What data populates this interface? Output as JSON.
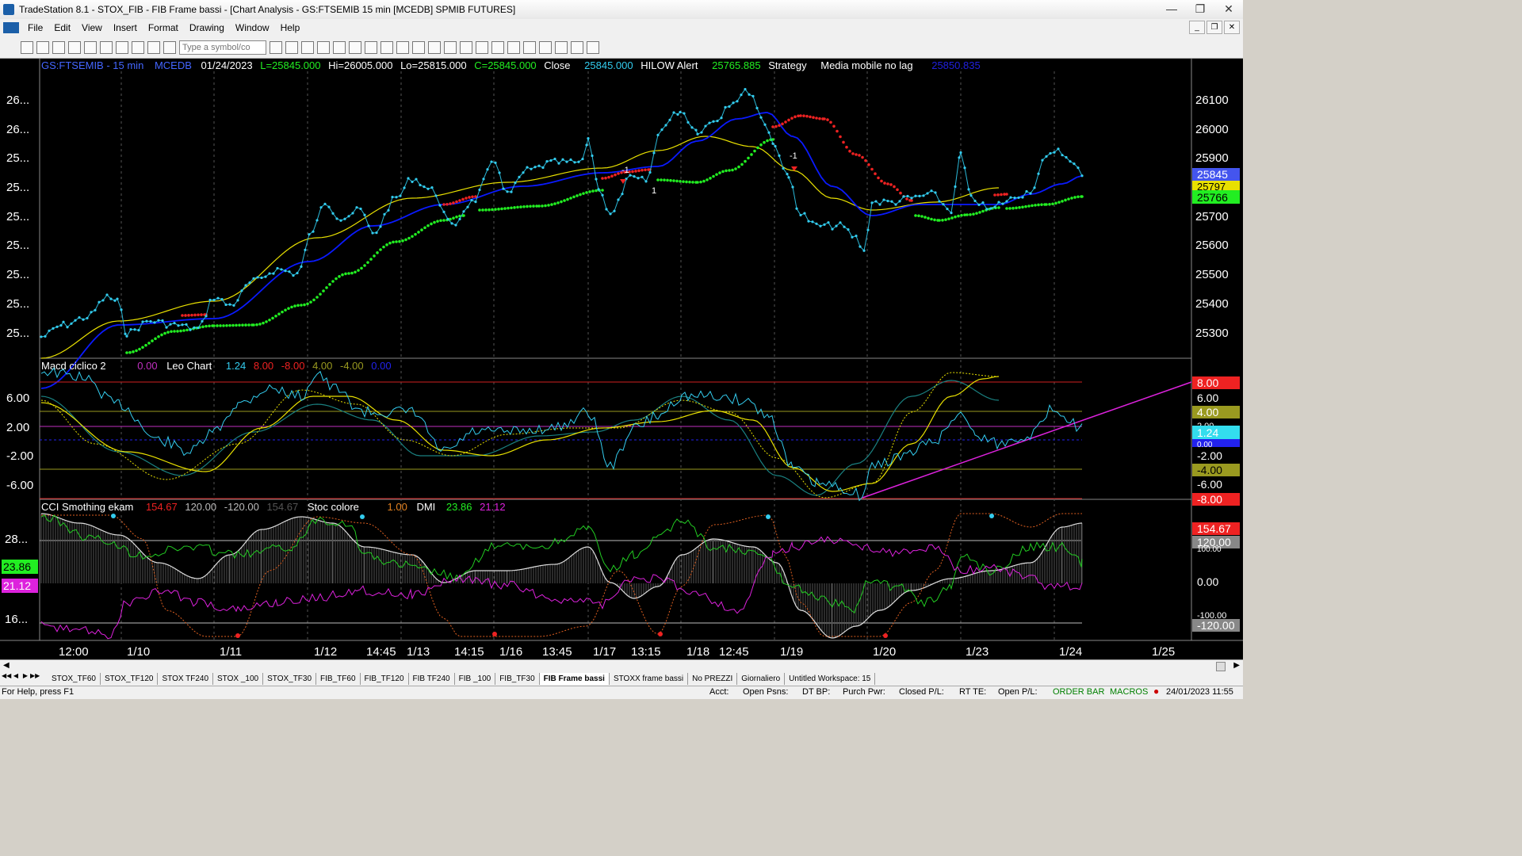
{
  "window": {
    "title": "TradeStation 8.1 - STOX_FIB - FIB Frame bassi - [Chart Analysis - GS:FTSEMIB  15 min  [MCEDB] SPMIB FUTURES]",
    "minimize": "—",
    "maximize": "❐",
    "close": "✕"
  },
  "menu": {
    "items": [
      "File",
      "Edit",
      "View",
      "Insert",
      "Format",
      "Drawing",
      "Window",
      "Help"
    ],
    "mdi": [
      "_",
      "❐",
      "✕"
    ]
  },
  "toolbar": {
    "symbol_placeholder": "Type a symbol/co"
  },
  "chart": {
    "header": {
      "symbol": "GS:FTSEMIB - 15 min",
      "exchange": "MCEDB",
      "date": "01/24/2023",
      "last": "L=25845.000",
      "high": "Hi=26005.000",
      "low": "Lo=25815.000",
      "close_val": "C=25845.000",
      "close_label": "Close",
      "close_num": "25845.000",
      "hilow_label": "HILOW Alert",
      "hilow_val": "25765.885",
      "strategy": "Strategy",
      "mm_label": "Media mobile no lag",
      "mm_val": "25850.835"
    },
    "price_axis": [
      "26100",
      "26000",
      "25900",
      "25800",
      "25700",
      "25600",
      "25500",
      "25400",
      "25300"
    ],
    "left_axis": [
      "26...",
      "26...",
      "25...",
      "25...",
      "25...",
      "25...",
      "25...",
      "25...",
      "25..."
    ],
    "price_tags": {
      "last": "25845",
      "yellow": "25797",
      "green": "25766"
    },
    "markers": {
      "m1": "-1",
      "m2": "1",
      "m3": "-1"
    },
    "macd": {
      "title": "Macd ciclico 2",
      "val1": "0.00",
      "leo": "Leo Chart",
      "v_cyan": "1.24",
      "v_red": "8.00",
      "v_red2": "-8.00",
      "v_olive": "4.00",
      "v_olive2": "-4.00",
      "v_blue": "0.00",
      "axis": [
        "6.00",
        "2.00",
        "-2.00",
        "-6.00"
      ],
      "tags": {
        "t8": "8.00",
        "t6": "6.00",
        "t4": "4.00",
        "t2": "2.00",
        "t124": "1.24",
        "t0": "0.00",
        "tm2": "-2.00",
        "tm4": "-4.00",
        "tm6": "-6.00",
        "tm8": "-8.00"
      }
    },
    "cci": {
      "title": "CCI Smothing ekam",
      "v1": "154.67",
      "v2": "120.00",
      "v3": "-120.00",
      "v4": "154.67",
      "stoc": "Stoc colore",
      "stoc_val": "1.00",
      "dmi": "DMI",
      "dmi_plus": "23.86",
      "dmi_minus": "21.12",
      "left_axis": [
        "28...",
        "16..."
      ],
      "left_tags": {
        "g": "23.86",
        "m": "21.12"
      },
      "right_tags": {
        "a": "154.67",
        "b": "120.00",
        "c": "100.00",
        "d": "0.00",
        "e": "-100.00",
        "f": "-120.00"
      }
    },
    "time_axis": [
      "12:00",
      "1/10",
      "1/11",
      "1/12",
      "14:45",
      "1/13",
      "14:15",
      "1/16",
      "13:45",
      "1/17",
      "13:15",
      "1/18",
      "12:45",
      "1/19",
      "1/20",
      "1/23",
      "1/24",
      "1/25"
    ],
    "colors": {
      "bg": "#000000",
      "price": "#33ccee",
      "ma_blue": "#0a1aff",
      "ma_yellow": "#e8e000",
      "hilow_green": "#22ee22",
      "hilow_red": "#ee2222",
      "magenta": "#dd22dd"
    }
  },
  "tabs": [
    "STOX_TF60",
    "STOX_TF120",
    "STOX TF240",
    "STOX _100",
    "STOX_TF30",
    "FIB_TF60",
    "FIB_TF120",
    "FIB TF240",
    "FIB _100",
    "FIB_TF30",
    "FIB Frame bassi",
    "STOXX frame bassi",
    "No PREZZI",
    "Giornaliero",
    "Untitled Workspace: 15"
  ],
  "status": {
    "help": "For Help, press F1",
    "acct": "Acct:",
    "open_psns": "Open Psns:",
    "dt_bp": "DT BP:",
    "purch_pwr": "Purch Pwr:",
    "closed_pl": "Closed P/L:",
    "rt_te": "RT TE:",
    "open_pl": "Open P/L:",
    "order_bar": "ORDER BAR",
    "macros": "MACROS",
    "datetime": "24/01/2023 11:55"
  }
}
